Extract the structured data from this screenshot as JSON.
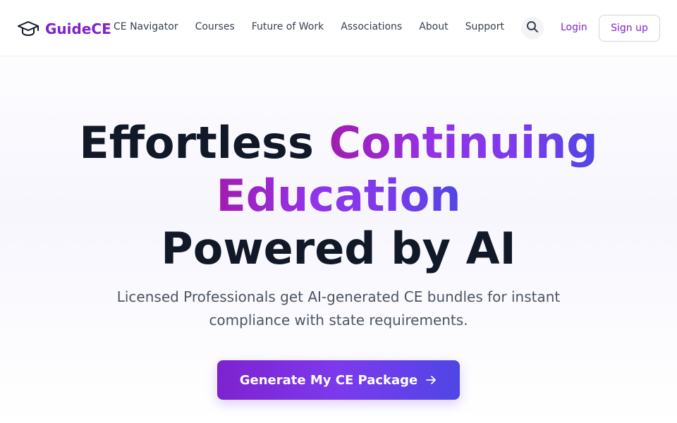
{
  "header": {
    "brand": {
      "name": "GuideCE",
      "icon": "graduation-cap-icon"
    },
    "nav": [
      {
        "label": "CE Navigator"
      },
      {
        "label": "Courses"
      },
      {
        "label": "Future of Work"
      },
      {
        "label": "Associations"
      },
      {
        "label": "About"
      },
      {
        "label": "Support"
      }
    ],
    "search": {
      "icon": "search-icon"
    },
    "login_label": "Login",
    "signup_label": "Sign up"
  },
  "hero": {
    "headline": {
      "part1": "Effortless ",
      "highlight1": "Continuing",
      "highlight2": "Education",
      "part2": "Powered by AI"
    },
    "subtitle": "Licensed Professionals get AI-generated CE bundles for instant compliance with state requirements.",
    "cta": {
      "label": "Generate My CE Package",
      "icon": "arrow-right-icon"
    }
  },
  "colors": {
    "brand": "#7e22ce",
    "gradient_start": "#a21caf",
    "gradient_end": "#4f46e5",
    "text_dark": "#111827",
    "text_muted": "#4b5563"
  }
}
